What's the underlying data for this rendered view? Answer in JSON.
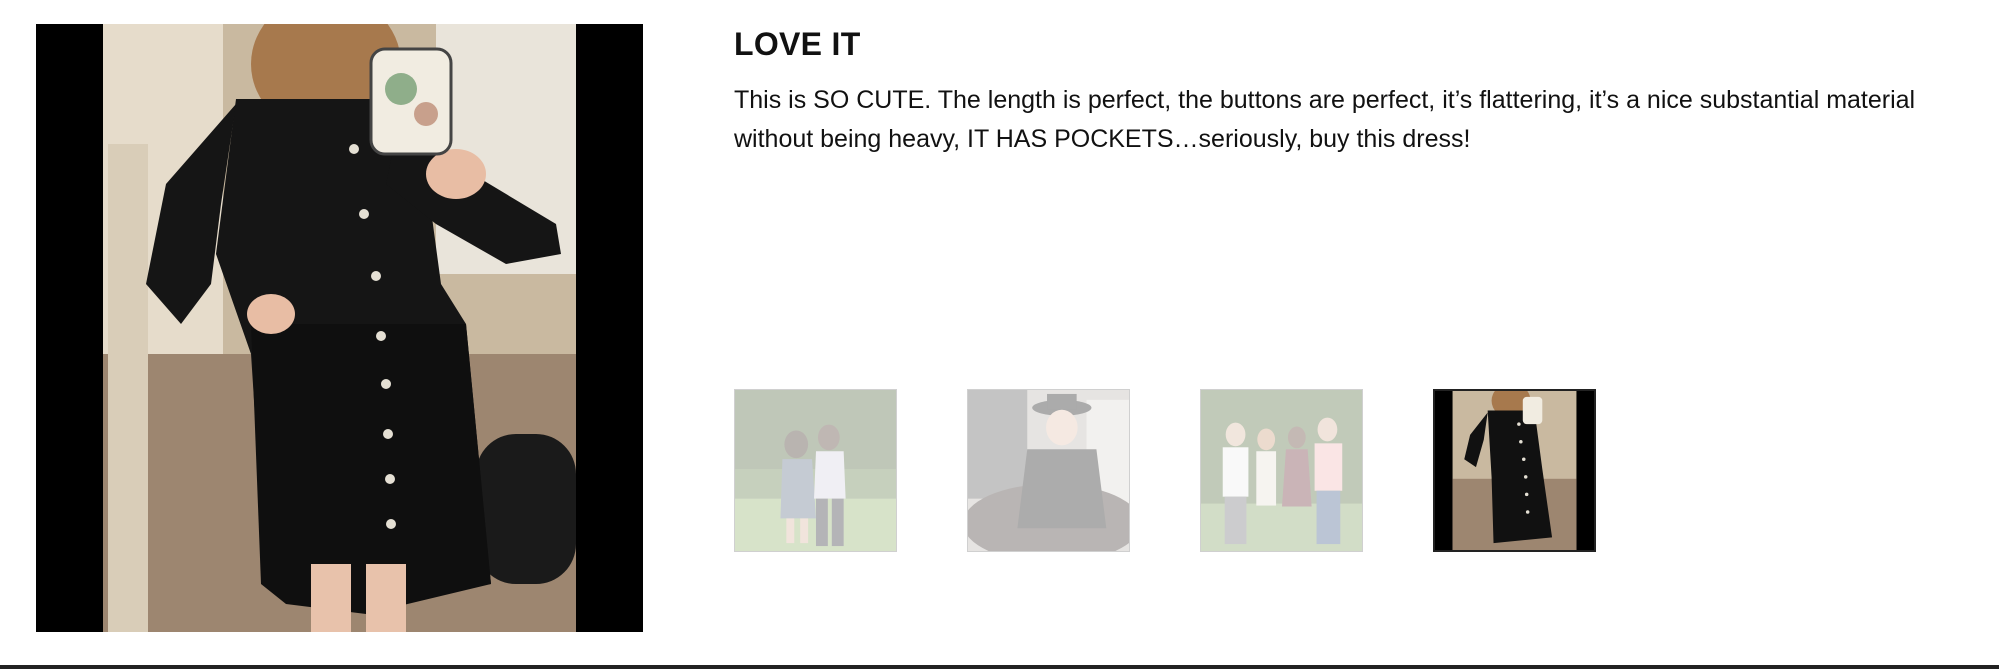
{
  "review": {
    "title": "LOVE IT",
    "body": "This is SO CUTE. The length is perfect, the buttons are perfect, it’s flattering, it’s a nice substantial material without being heavy, IT HAS POCKETS…seriously, buy this dress!"
  },
  "main_image": {
    "icon": "photo-dress-mirror-selfie"
  },
  "thumbnails": [
    {
      "icon": "photo-couple-outdoors",
      "selected": false
    },
    {
      "icon": "photo-woman-black-hat",
      "selected": false
    },
    {
      "icon": "photo-group-of-four",
      "selected": false
    },
    {
      "icon": "photo-dress-mirror-selfie",
      "selected": true
    }
  ],
  "colors": {
    "text": "#111111",
    "thumb_border": "#d0d0d0",
    "selected_border": "#222222"
  }
}
